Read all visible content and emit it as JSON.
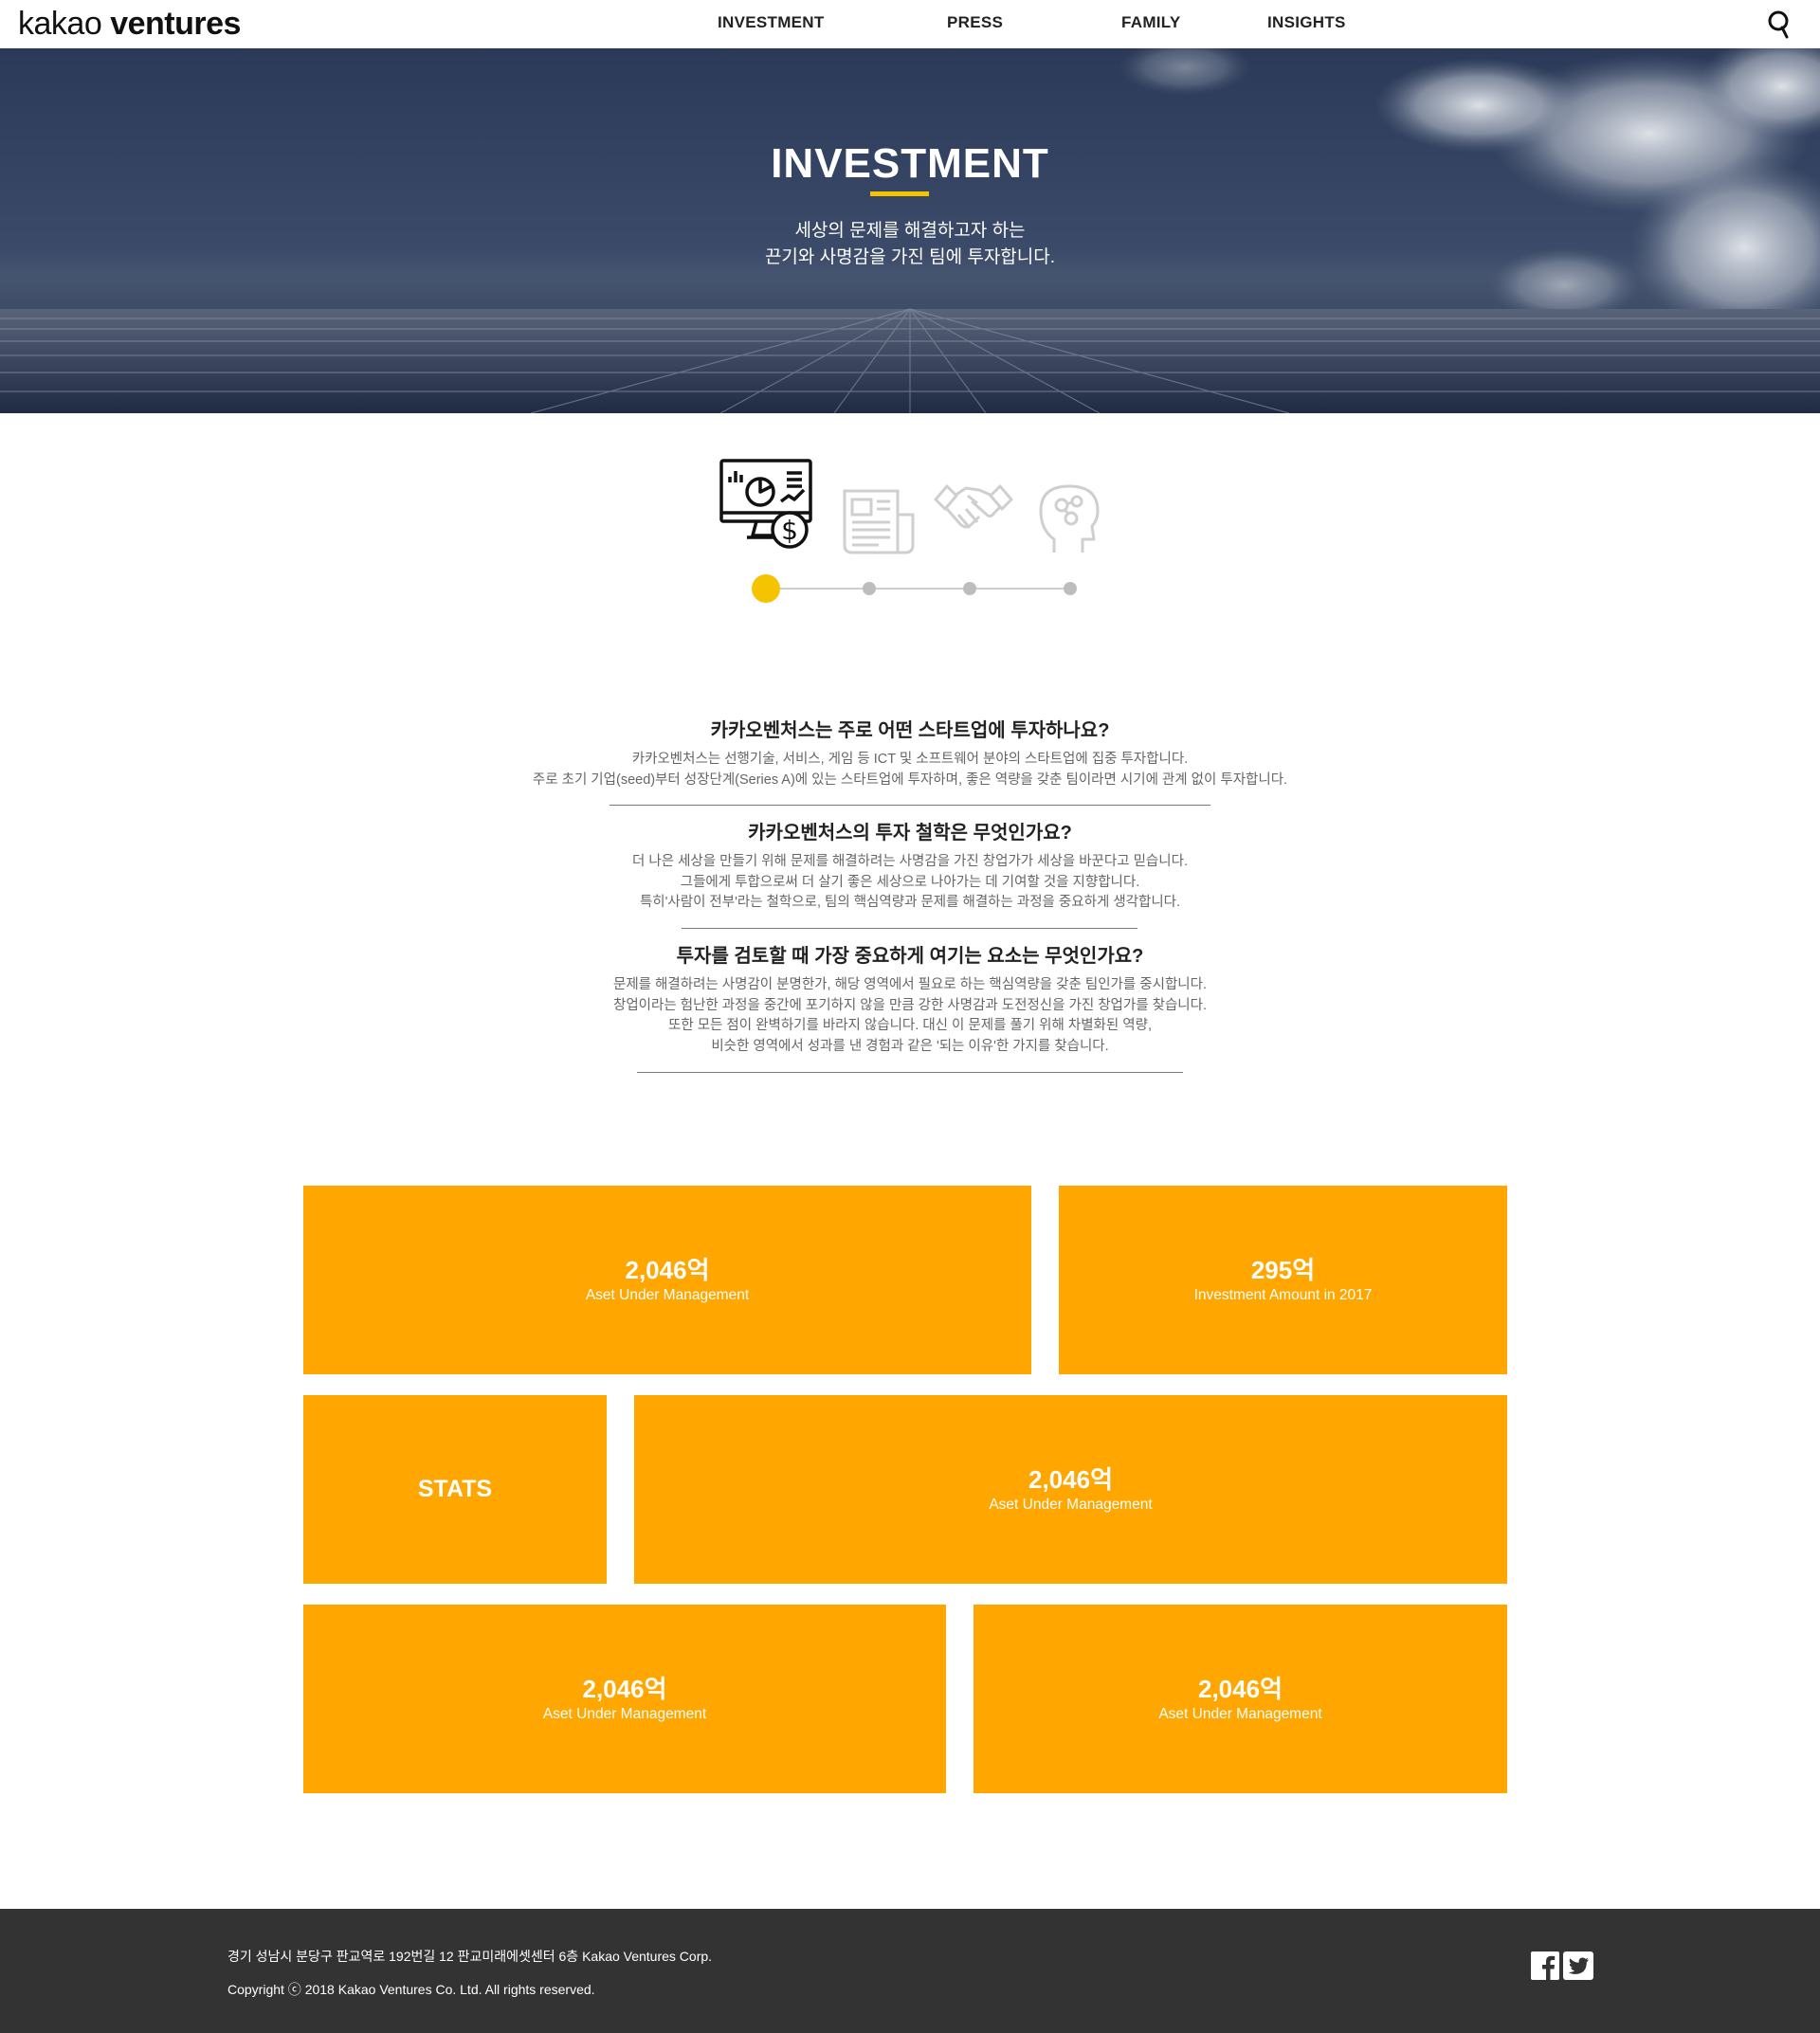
{
  "header": {
    "logo_light": "kakao",
    "logo_bold": "ventures",
    "nav": [
      "INVESTMENT",
      "PRESS",
      "FAMILY",
      "INSIGHTS"
    ]
  },
  "hero": {
    "title": "INVESTMENT",
    "subtitle_line1": "세상의 문제를 해결하고자 하는",
    "subtitle_line2": "끈기와 사명감을 가진 팀에 투자합니다."
  },
  "steps": {
    "active_index": 0,
    "icons": [
      "investment-monitor-icon",
      "newspaper-icon",
      "handshake-icon",
      "head-network-icon"
    ]
  },
  "faq": [
    {
      "question": "카카오벤처스는 주로 어떤 스타트업에 투자하나요?",
      "answer": [
        "카카오벤처스는 선행기술, 서비스, 게임 등 ICT 및 소프트웨어 분야의 스타트업에 집중 투자합니다.",
        "주로 초기 기업(seed)부터 성장단계(Series A)에 있는 스타트업에 투자하며, 좋은 역량을 갖춘 팀이라면 시기에 관계 없이 투자합니다."
      ]
    },
    {
      "question": "카카오벤처스의 투자 철학은 무엇인가요?",
      "answer": [
        "더 나은 세상을 만들기 위해 문제를 해결하려는 사명감을 가진 창업가가 세상을 바꾼다고 믿습니다.",
        "그들에게 투합으로써 더 살기 좋은 세상으로 나아가는 데 기여할 것을 지향합니다.",
        "특히'사람이 전부'라는 철학으로, 팀의 핵심역량과 문제를 해결하는 과정을 중요하게 생각합니다."
      ]
    },
    {
      "question": "투자를 검토할 때 가장 중요하게 여기는 요소는 무엇인가요?",
      "answer": [
        "문제를 해결하려는 사명감이 분명한가, 해당 영역에서 필요로 하는 핵심역량을 갖춘 팀인가를 중시합니다.",
        "창업이라는 험난한 과정을 중간에 포기하지 않을 만큼 강한 사명감과 도전정신을 가진 창업가를 찾습니다.",
        "또한 모든 점이 완벽하기를 바라지 않습니다. 대신 이 문제를 풀기 위해 차별화된 역량,",
        "비슷한 영역에서 성과를 낸 경험과 같은 '되는 이유'한 가지를 찾습니다."
      ]
    }
  ],
  "stats": {
    "label": "STATS",
    "tiles": [
      {
        "value": "2,046억",
        "label": "Aset Under Management"
      },
      {
        "value": "295억",
        "label": "Investment Amount in 2017"
      },
      {
        "value": "2,046억",
        "label": "Aset Under Management"
      },
      {
        "value": "2,046억",
        "label": "Aset Under Management"
      },
      {
        "value": "2,046억",
        "label": "Aset Under Management"
      }
    ]
  },
  "footer": {
    "address": "경기 성남시 분당구 판교역로 192번길 12 판교미래에셋센터 6층 Kakao Ventures Corp.",
    "copyright": "Copyright ⓒ 2018 Kakao Ventures Co. Ltd. All rights reserved.",
    "social": [
      "facebook-icon",
      "twitter-icon"
    ]
  },
  "colors": {
    "accent_yellow": "#f5c400",
    "tile_orange": "#ffa600",
    "footer_bg": "#333333",
    "hero_navy": "#2b3a58"
  }
}
